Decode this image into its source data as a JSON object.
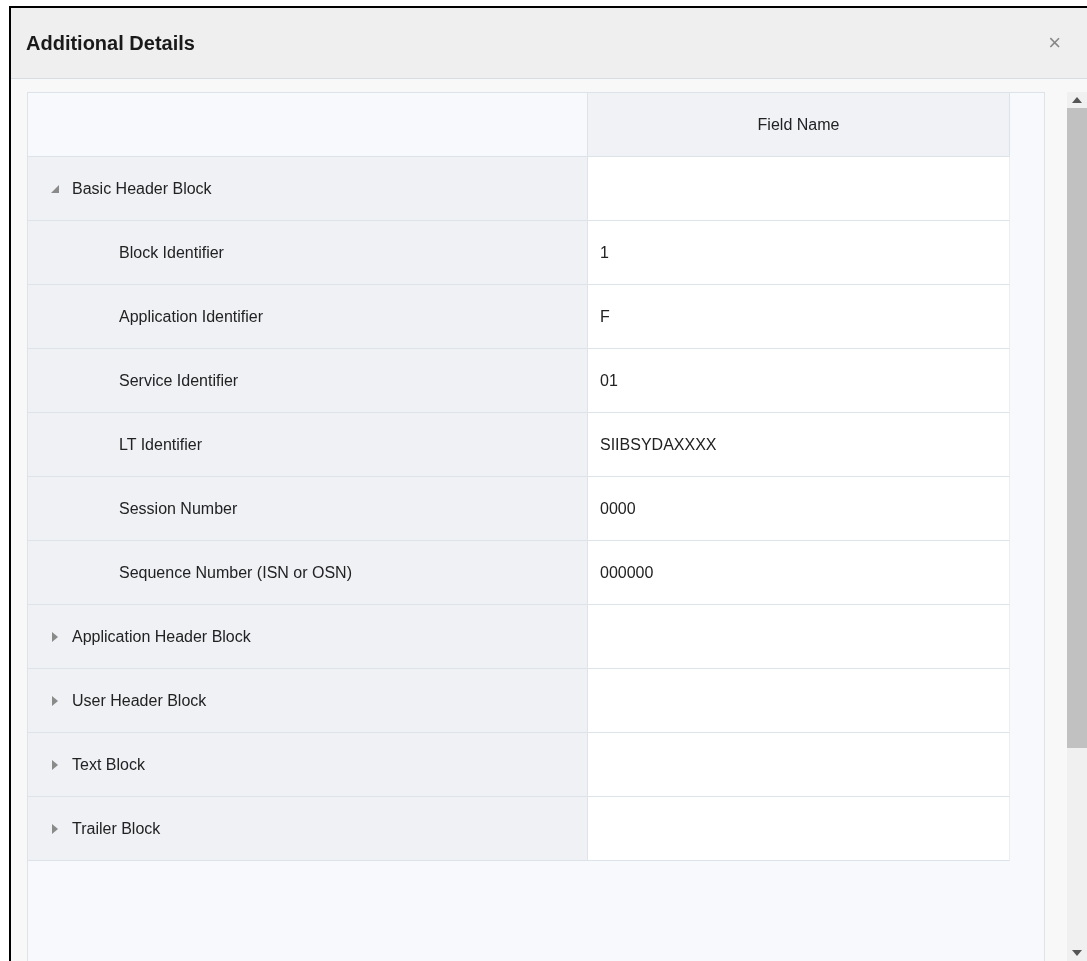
{
  "dialog": {
    "title": "Additional Details",
    "close": "×"
  },
  "table": {
    "columns": [
      "Field Name"
    ],
    "rows": [
      {
        "label": "Basic Header Block",
        "expanded": true,
        "children": [
          {
            "label": "Block Identifier",
            "value": "1"
          },
          {
            "label": "Application Identifier",
            "value": "F"
          },
          {
            "label": "Service Identifier",
            "value": "01"
          },
          {
            "label": "LT Identifier",
            "value": "SIIBSYDAXXXX"
          },
          {
            "label": "Session Number",
            "value": "0000"
          },
          {
            "label": "Sequence Number (ISN or OSN)",
            "value": "000000"
          }
        ]
      },
      {
        "label": "Application Header Block",
        "expanded": false
      },
      {
        "label": "User Header Block",
        "expanded": false
      },
      {
        "label": "Text Block",
        "expanded": false
      },
      {
        "label": "Trailer Block",
        "expanded": false
      }
    ]
  }
}
